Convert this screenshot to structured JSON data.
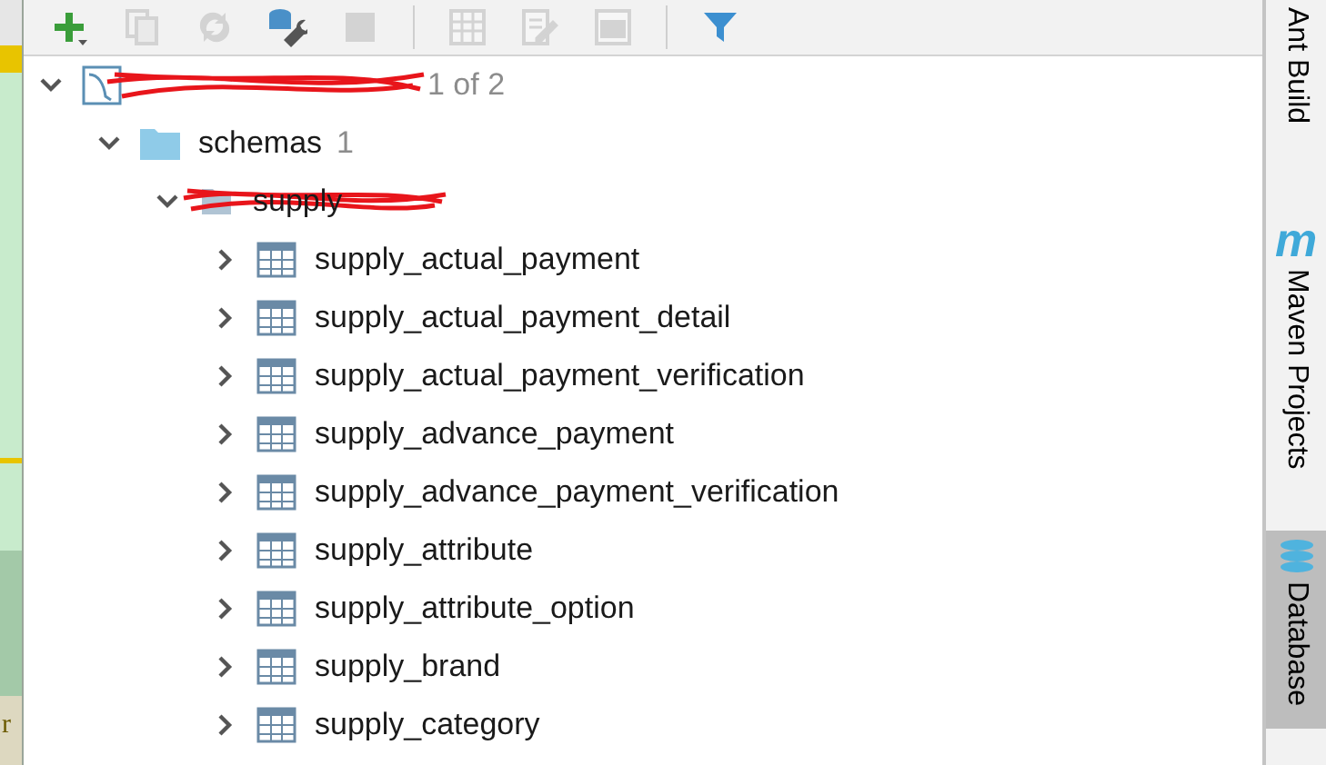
{
  "toolbar": [
    {
      "kind": "add",
      "disabled": false
    },
    {
      "kind": "copy",
      "disabled": true
    },
    {
      "kind": "refresh",
      "disabled": true
    },
    {
      "kind": "properties",
      "disabled": false
    },
    {
      "kind": "stop",
      "disabled": true
    },
    {
      "kind": "separator"
    },
    {
      "kind": "table",
      "disabled": true
    },
    {
      "kind": "edit",
      "disabled": true
    },
    {
      "kind": "console",
      "disabled": true
    },
    {
      "kind": "separator"
    },
    {
      "kind": "filter",
      "disabled": false
    }
  ],
  "tree": [
    {
      "kind": "connection",
      "count": "1 of 2",
      "redacted": true,
      "expanded": true,
      "children": [
        {
          "kind": "folder",
          "label": "schemas",
          "count": "1",
          "expanded": true,
          "children": [
            {
              "kind": "schema",
              "label": "supply",
              "redacted": true,
              "expanded": true,
              "children": [
                {
                  "kind": "table",
                  "label": "supply_actual_payment",
                  "expanded": false
                },
                {
                  "kind": "table",
                  "label": "supply_actual_payment_detail",
                  "expanded": false
                },
                {
                  "kind": "table",
                  "label": "supply_actual_payment_verification",
                  "expanded": false
                },
                {
                  "kind": "table",
                  "label": "supply_advance_payment",
                  "expanded": false
                },
                {
                  "kind": "table",
                  "label": "supply_advance_payment_verification",
                  "expanded": false
                },
                {
                  "kind": "table",
                  "label": "supply_attribute",
                  "expanded": false
                },
                {
                  "kind": "table",
                  "label": "supply_attribute_option",
                  "expanded": false
                },
                {
                  "kind": "table",
                  "label": "supply_brand",
                  "expanded": false
                },
                {
                  "kind": "table",
                  "label": "supply_category",
                  "expanded": false
                }
              ]
            }
          ]
        }
      ]
    }
  ],
  "editor_edge": {
    "text": "r"
  },
  "side_tabs": [
    {
      "kind": "plain",
      "label": "Ant Build",
      "selected": false
    },
    {
      "kind": "maven",
      "icon": "m",
      "label": "Maven Projects",
      "selected": false
    },
    {
      "kind": "database",
      "label": "Database",
      "selected": true
    }
  ]
}
